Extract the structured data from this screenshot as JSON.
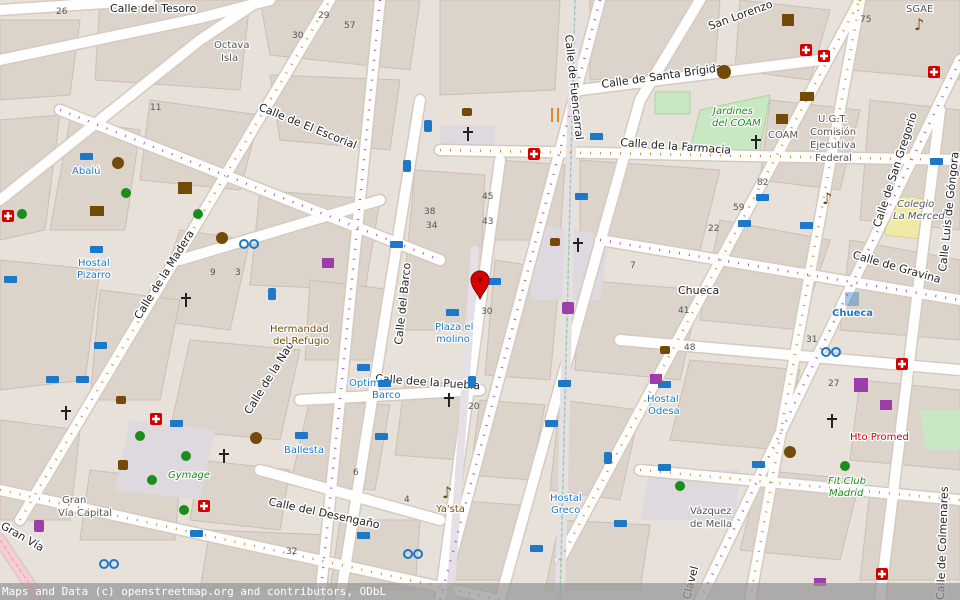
{
  "colors": {
    "background": "#f2efe9",
    "building": "#dcd3cb",
    "road": "#ffffff",
    "road_casing": "#d8d0c8",
    "pedestrian": "#e0dcdc",
    "park": "#c8e8c4",
    "hospital": "#d40000",
    "poi_blue": "#1d78c8",
    "poi_brown": "#734a08",
    "poi_green": "#1a8d1a",
    "poi_purple": "#9c3ea8",
    "marker": "#d70000"
  },
  "streets": {
    "tesoro": "Calle del Tesoro",
    "escorial": "Calle de El Escorial",
    "madera": "Calle de la Madera",
    "barco": "Calle del Barco",
    "puebla": "Calle dee la Puebla",
    "nao": "Calle de la Nao",
    "desengano": "Calle del Desengaño",
    "gran_via": "Gran Vía",
    "fuencarral": "Calle de Fuencarral",
    "santa_brigida": "Calle de Santa Brígida",
    "farmacia": "Calle de la Farmacia",
    "san_lorenzo": "San Lorenzo",
    "san_gregorio": "Calle de San Gregorio",
    "luis_gongora": "Calle Luis de Góngora",
    "gravina": "Calle de Gravina",
    "clavel": "Clavel",
    "colmenares": "Calle de Colmenares",
    "chueca_street": "Chueca"
  },
  "places": {
    "octava_isla_1": "Octava",
    "octava_isla_2": "Isla",
    "abalu": "Abalú",
    "hostal_pizarro_1": "Hostal",
    "hostal_pizarro_2": "Pizarro",
    "hermandad_1": "Hermandad",
    "hermandad_2": "del Refugio",
    "plaza_molino_1": "Plaza el",
    "plaza_molino_2": "molino",
    "optimi_1": "Optimi",
    "optimi_2": "Barco",
    "ballesta": "Ballesta",
    "gymage": "Gymage",
    "gran_via_capital_1": "Gran",
    "gran_via_capital_2": "Vía Capital",
    "yasta": "Ya'sta",
    "hostal_greco_1": "Hostal",
    "hostal_greco_2": "Greco",
    "hostal_odesa_1": "Hostal",
    "hostal_odesa_2": "Odesa",
    "vazquez_1": "Vázquez",
    "vazquez_2": "de Mella",
    "jardines_1": "Jardines",
    "jardines_2": "del COAM",
    "coam": "COAM",
    "ugt_1": "U.G.T.",
    "ugt_2": "Comisión",
    "ugt_3": "Ejecutiva",
    "ugt_4": "Federal",
    "colegio_1": "Colegio",
    "colegio_2": "La Merced",
    "chueca_metro": "Chueca",
    "hto_promed": "Hto Promed",
    "fit_club_1": "Fit Club",
    "fit_club_2": "Madrid",
    "sgae": "SGAE"
  },
  "house_numbers": {
    "n26": "26",
    "n57": "57",
    "n11": "11",
    "n29": "29",
    "n30": "30",
    "n38": "38",
    "n34": "34",
    "n45": "45",
    "n41": "41",
    "n43": "43",
    "n27": "27",
    "n82": "82",
    "n59": "59",
    "n22": "22",
    "n20": "20",
    "n32": "32",
    "n48": "48",
    "n31": "31",
    "n30b": "30",
    "n75": "75",
    "n9": "9",
    "n3": "3",
    "n4": "4",
    "n6": "6",
    "n7": "7"
  },
  "icons": [
    "hospital-icon",
    "church-icon",
    "hotel-icon",
    "theatre-icon",
    "gym-icon",
    "bicycle-icon",
    "bus-stop-icon",
    "cafe-icon",
    "restaurant-icon",
    "music-icon",
    "art-icon",
    "post-office-icon",
    "shop-icon",
    "library-icon",
    "location-marker-icon"
  ],
  "attribution": "Maps and Data (c) openstreetmap.org and contributors, ODbL"
}
